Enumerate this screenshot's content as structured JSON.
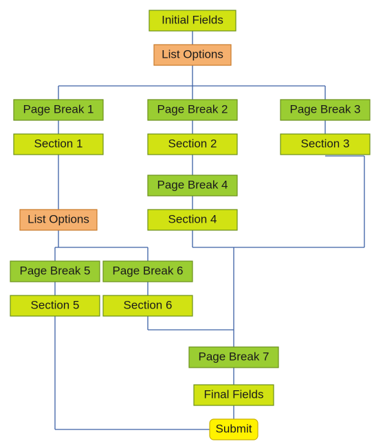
{
  "nodes": {
    "initial_fields": "Initial Fields",
    "list_options_top": "List Options",
    "page_break_1": "Page Break 1",
    "page_break_2": "Page Break 2",
    "page_break_3": "Page Break 3",
    "section_1": "Section 1",
    "section_2": "Section 2",
    "section_3": "Section 3",
    "page_break_4": "Page Break 4",
    "section_4": "Section 4",
    "list_options_left": "List Options",
    "page_break_5": "Page Break 5",
    "page_break_6": "Page Break 6",
    "section_5": "Section 5",
    "section_6": "Section 6",
    "page_break_7": "Page Break 7",
    "final_fields": "Final Fields",
    "submit": "Submit"
  }
}
